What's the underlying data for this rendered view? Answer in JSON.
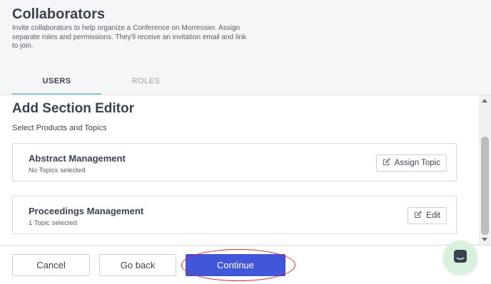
{
  "header": {
    "title": "Collaborators",
    "description": "Invite collaborators to help organize a Conference on Morressier. Assign separate roles and permissions. They'll receive an invitation email and link to join.",
    "tabs": [
      {
        "label": "USERS",
        "active": true
      },
      {
        "label": "ROLES",
        "active": false
      }
    ]
  },
  "main": {
    "title": "Add Section Editor",
    "subtitle": "Select Products and Topics",
    "cards": [
      {
        "title": "Abstract Management",
        "status": "No Topics selected",
        "button": "Assign Topic",
        "icon": "edit-icon"
      },
      {
        "title": "Proceedings Management",
        "status": "1 Topic selected",
        "button": "Edit",
        "icon": "edit-icon"
      }
    ]
  },
  "footer": {
    "cancel_label": "Cancel",
    "back_label": "Go back",
    "continue_label": "Continue"
  },
  "colors": {
    "primary": "#4256d9",
    "tab_underline": "#87c9c5",
    "highlight": "#d5262a",
    "chat_bg": "#d7f1dd"
  },
  "chat": {
    "icon": "chat-icon"
  }
}
